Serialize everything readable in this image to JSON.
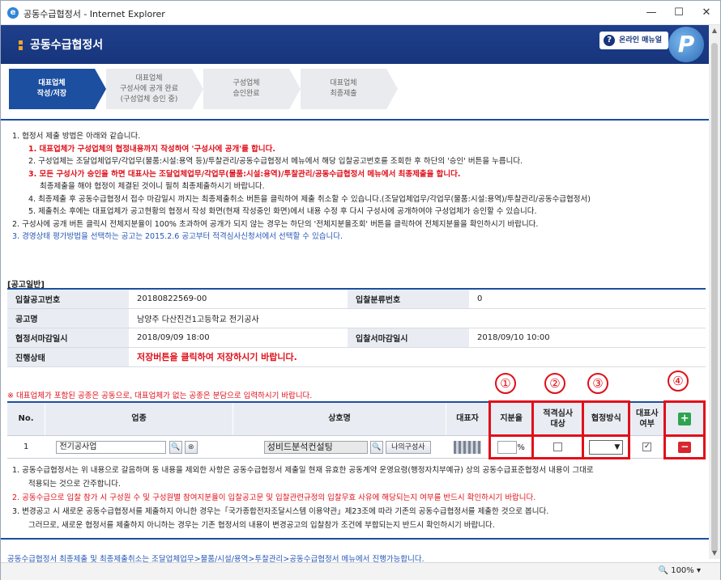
{
  "window": {
    "title": "공동수급협정서 - Internet Explorer",
    "ctrl_min": "—",
    "ctrl_max": "☐",
    "ctrl_close": "✕"
  },
  "banner": {
    "title": "공동수급협정서",
    "manual_label": "온라인 매뉴얼",
    "manual_icon": "?",
    "logo": "P"
  },
  "steps": [
    {
      "label": "대표업체\n작성/저장"
    },
    {
      "label": "대표업체\n구성사에 공개 완료\n(구성업체 승인 중)"
    },
    {
      "label": "구성업체\n승인완료"
    },
    {
      "label": "대표업체\n최종제출"
    }
  ],
  "notes": {
    "n1": "1.  협정서 제출 방법은 아래와 같습니다.",
    "n1_1": "1.  대표업체가 구성업체의 협정내용까지 작성하여 '구성사에 공개'를 합니다.",
    "n1_2": "2.  구성업체는 조달업체업무/각업무(물품:시설:용역 등)/투찰관리/공동수급협정서 메뉴에서 해당 입찰공고번호를 조회한 후 하단의 '승인' 버튼을 누릅니다.",
    "n1_3": "3.  모든 구성사가 승인을 하면 대표사는 조달업체업무/각업무(물품:시설:용역)/투찰관리/공동수급협정서 메뉴에서 최종제출을 합니다.",
    "n1_3b": "최종제출을 해야 협정이 체결된 것이니 필히 최종제출하시기 바랍니다.",
    "n1_4": "4.  최종제출 후 공동수급협정서 접수 마감일시 까지는 최종제출취소 버튼을 클릭하여 제출 취소할 수 있습니다.(조달업체업무/각업무(물품:시설:용역)/투찰관리/공동수급협정서)",
    "n1_5": "5.  제출취소 후에는 대표업체가 공고현황의 협정서 작성 화면(현재 작성중인 화면)에서 내용 수정 후 다시 구성사에 공개하여야 구성업체가 승인할 수 있습니다.",
    "n2": "2.  구성사에 공개 버튼 클릭시 전체지분율이 100% 초과하여 공개가 되지 않는 경우는 하단의 '전체지분율조회' 버튼을 클릭하여 전체지분율을 확인하시기 바랍니다.",
    "n3": "3.  경영상태 평가방법을 선택하는 공고는 2015.2.6 공고부터 적격심사신청서에서 선택할 수 있습니다."
  },
  "section_title": "[공고일반]",
  "info": {
    "bid_no_label": "입찰공고번호",
    "bid_no": "20180822569-00",
    "bid_class_label": "입찰분류번호",
    "bid_class": "0",
    "name_label": "공고명",
    "name": "남양주 다산진건1고등학교 전기공사",
    "deadline_label": "협정서마감일시",
    "deadline": "2018/09/09 18:00",
    "bid_deadline_label": "입찰서마감일시",
    "bid_deadline": "2018/09/10 10:00",
    "status_label": "진행상태",
    "status": "저장버튼을 클릭하여 저장하시기 바랍니다."
  },
  "warning": "※ 대표업체가 포함된 공종은 공동으로, 대표업체가 없는 공종은 분담으로 입력하시기 바랍니다.",
  "grid": {
    "headers": {
      "no": "No.",
      "type": "업종",
      "company": "상호명",
      "rep": "대표자",
      "share": "지분율",
      "qualify": "적격심사\n대상",
      "method": "협정방식",
      "rep_yn": "대표사\n여부"
    },
    "row": {
      "no": "1",
      "type": "전기공사업",
      "company": "성비드분석컨설팅",
      "my_company_btn": "나의구성사",
      "share_unit": "%",
      "select_arrow": "▼",
      "rep_check": "✓"
    },
    "search_icon": "🔍",
    "clear_icon": "⊗",
    "plus": "+",
    "minus": "−"
  },
  "markers": [
    "①",
    "②",
    "③",
    "④"
  ],
  "notes2": {
    "a1": "1.  공동수급협정서는 위 내용으로 갈음하며 동 내용을 제외한 사항은 공동수급협정서 제출일 현재 유효한 공동계약 운영요령(행정자치부예규) 상의 공동수급표준협정서 내용이 그대로",
    "a1b": "적용되는 것으로 간주합니다.",
    "a2": "2.  공동수급으로 입찰 참가 시 구성원 수 및 구성원별 참여지분율이 입찰공고문 및 입찰관련규정의 입찰무효 사유에 해당되는지 여부를 반드시 확인하시기 바랍니다.",
    "a3": "3.  변경공고 시 새로운 공동수급협정서를 제출하지 아니한 경우는「국가종합전자조달시스템 이용약관」제23조에 따라 기존의 공동수급협정서를 제출한 것으로 봅니다.",
    "a3b": "그러므로, 새로운 협정서를 제출하지 아니하는 경우는 기존 협정서의 내용이 변경공고의 입찰참가 조건에 부합되는지 반드시 확인하시기 바랍니다."
  },
  "footer": "공동수급협정서 최종제출 및 최종제출취소는 조달업체업무>물품/시설/용역>투찰관리>공동수급협정서 메뉴에서 진행가능합니다.",
  "status_bar": {
    "zoom": "🔍 100%  ▾"
  }
}
